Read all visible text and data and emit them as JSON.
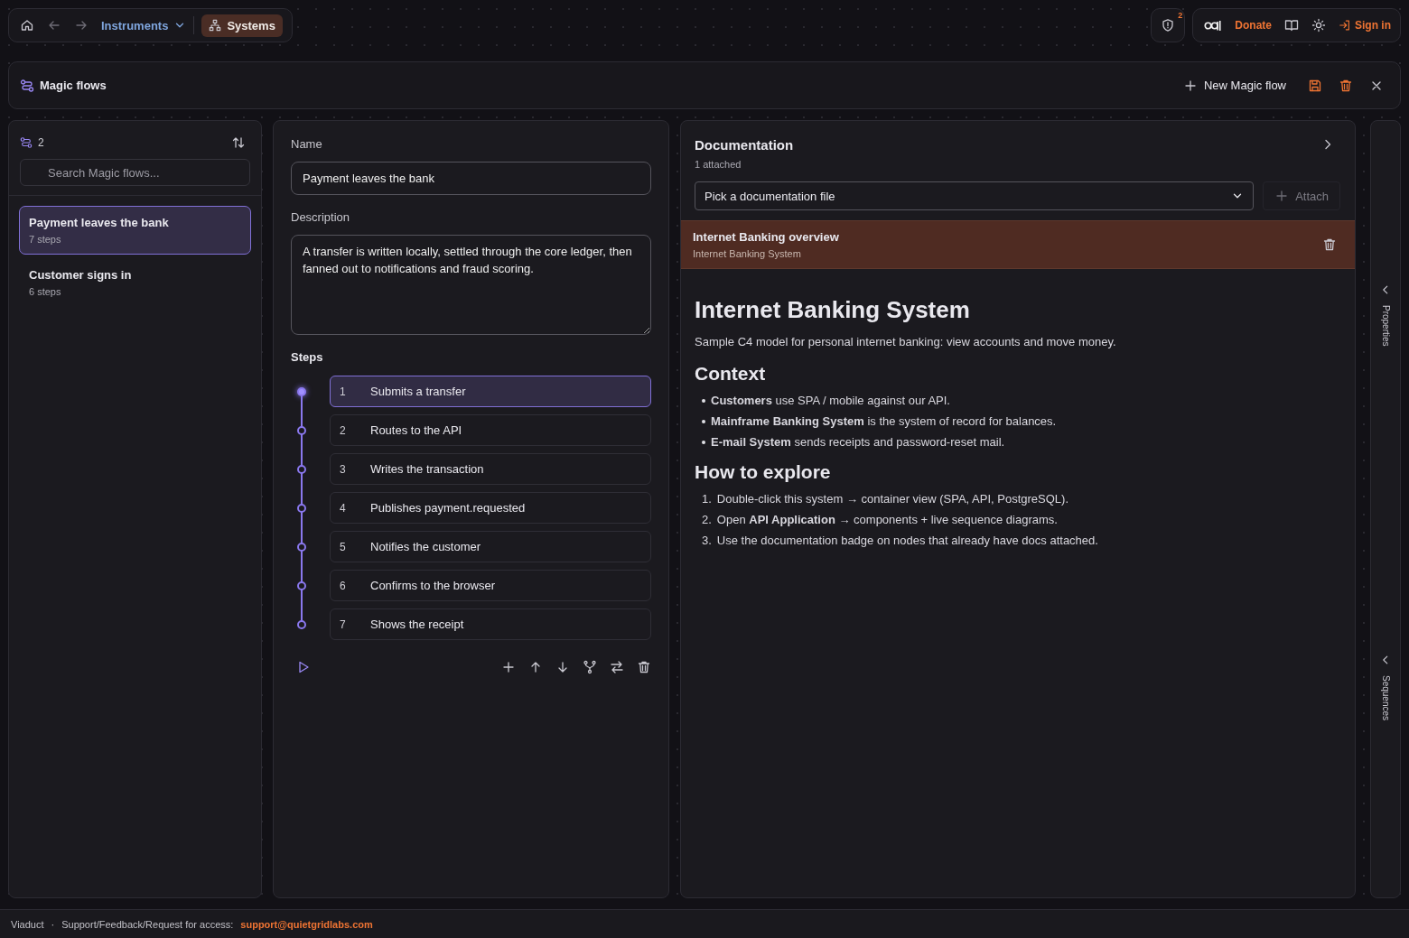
{
  "nav": {
    "instruments": "Instruments",
    "systems": "Systems"
  },
  "alerts": {
    "count": "2"
  },
  "account": {
    "donate": "Donate",
    "sign_in": "Sign in"
  },
  "panel": {
    "title": "Magic flows",
    "new_button": "New Magic flow"
  },
  "flows": {
    "count": "2",
    "search_placeholder": "Search Magic flows...",
    "items": [
      {
        "title": "Payment leaves the bank",
        "steps": "7 steps",
        "selected": true
      },
      {
        "title": "Customer signs in",
        "steps": "6 steps",
        "selected": false
      }
    ]
  },
  "editor": {
    "name_label": "Name",
    "name_value": "Payment leaves the bank",
    "description_label": "Description",
    "description_value": "A transfer is written locally, settled through the core ledger, then fanned out to notifications and fraud scoring.",
    "steps_label": "Steps",
    "steps": [
      {
        "number": "1",
        "label": "Submits a transfer",
        "selected": true
      },
      {
        "number": "2",
        "label": "Routes to the API",
        "selected": false
      },
      {
        "number": "3",
        "label": "Writes the transaction",
        "selected": false
      },
      {
        "number": "4",
        "label": "Publishes payment.requested",
        "selected": false
      },
      {
        "number": "5",
        "label": "Notifies the customer",
        "selected": false
      },
      {
        "number": "6",
        "label": "Confirms to the browser",
        "selected": false
      },
      {
        "number": "7",
        "label": "Shows the receipt",
        "selected": false
      }
    ]
  },
  "documentation": {
    "title": "Documentation",
    "subtitle": "1 attached",
    "picker": "Pick a documentation file",
    "attach": "Attach",
    "attached": [
      {
        "title": "Internet Banking overview",
        "system": "Internet Banking System"
      }
    ],
    "doc": {
      "heading": "Internet Banking System",
      "intro": "Sample C4 model for personal internet banking: view accounts and move money.",
      "sections": [
        {
          "heading": "Context",
          "kind": "bullets",
          "items": [
            "**Customers** use SPA / mobile against our API.",
            "**Mainframe Banking System** is the system of record for balances.",
            "**E-mail System** sends receipts and password-reset mail."
          ]
        },
        {
          "heading": "How to explore",
          "kind": "numbered",
          "markers": [
            "1.",
            "2.",
            "3."
          ],
          "items": [
            "Double-click this system → container view (SPA, API, PostgreSQL).",
            "Open **API Application** → components + live sequence diagrams.",
            "Use the documentation badge on nodes that already have docs attached."
          ]
        }
      ]
    }
  },
  "rail": [
    {
      "label": "Properties"
    },
    {
      "label": "Sequences"
    }
  ],
  "footer": {
    "app": "Viaduct",
    "separator": "·",
    "support": "Support/Feedback/Request for access:",
    "email": "support@quietgridlabs.com"
  }
}
